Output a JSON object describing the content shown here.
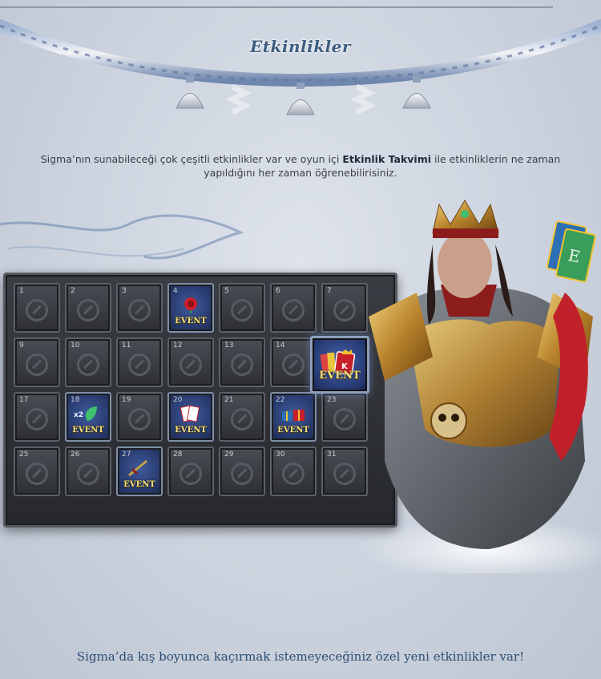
{
  "header": {
    "title": "Etkinlikler"
  },
  "intro": {
    "part1": "Sigma’nın sunabileceği çok çeşitli etkinlikler var ve oyun içi ",
    "bold": "Etkinlik Takvimi",
    "part2": " ile etkinliklerin ne zaman yapıldığını her zaman öğrenebilirisiniz."
  },
  "calendar": {
    "event_label": "EVENT",
    "days": [
      {
        "day": "1",
        "event": false
      },
      {
        "day": "2",
        "event": false
      },
      {
        "day": "3",
        "event": false
      },
      {
        "day": "4",
        "event": true,
        "icon": "rose-icon"
      },
      {
        "day": "5",
        "event": false
      },
      {
        "day": "6",
        "event": false
      },
      {
        "day": "7",
        "event": false
      },
      {
        "day": "9",
        "event": false
      },
      {
        "day": "10",
        "event": false
      },
      {
        "day": "11",
        "event": false
      },
      {
        "day": "12",
        "event": false
      },
      {
        "day": "13",
        "event": false
      },
      {
        "day": "14",
        "event": false
      },
      {
        "day": "",
        "event": false,
        "hidden": true
      },
      {
        "day": "17",
        "event": false
      },
      {
        "day": "18",
        "event": true,
        "icon": "x2-leaf-icon",
        "badge": "x2"
      },
      {
        "day": "19",
        "event": false
      },
      {
        "day": "20",
        "event": true,
        "icon": "cards-icon"
      },
      {
        "day": "21",
        "event": false
      },
      {
        "day": "22",
        "event": true,
        "icon": "gift-icon"
      },
      {
        "day": "23",
        "event": false
      },
      {
        "day": "25",
        "event": false
      },
      {
        "day": "26",
        "event": false
      },
      {
        "day": "27",
        "event": true,
        "icon": "sword-icon"
      },
      {
        "day": "28",
        "event": false
      },
      {
        "day": "29",
        "event": false
      },
      {
        "day": "30",
        "event": false
      },
      {
        "day": "31",
        "event": false
      }
    ],
    "featured": {
      "event": true,
      "icon": "card-king-icon"
    }
  },
  "footer": {
    "tagline": "Sigma’da kış boyunca kaçırmak istemeyeceğiniz özel yeni etkinlikler var!"
  },
  "colors": {
    "title": "#3d5c80",
    "event_text": "#f6e27a",
    "event_bg": "#26386a"
  }
}
